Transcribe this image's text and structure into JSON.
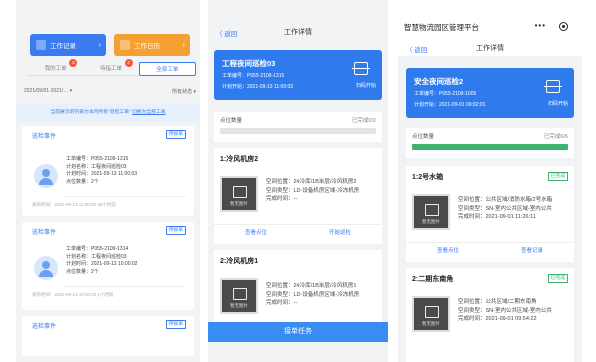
{
  "panel1": {
    "quick_actions": [
      {
        "label": "工作记录",
        "arrow": "›",
        "color": "#3a7cf0"
      },
      {
        "label": "工作日历",
        "arrow": "›",
        "color": "#f5a033"
      }
    ],
    "tabs": [
      {
        "label": "我的工单",
        "badge": "3"
      },
      {
        "label": "待指工单",
        "badge": "2"
      },
      {
        "label": "全部工单",
        "badge": ""
      }
    ],
    "filter": {
      "date": "2021/09/01-2021/…",
      "date_arrow": "▾",
      "status": "所有状态",
      "status_arrow": "▾"
    },
    "notice": {
      "text": "当前展示的列表为本月所有\"巡检工单\"",
      "link": "切换为全部工单"
    },
    "cards": [
      {
        "title": "巡检事件",
        "tag": "待接单",
        "no": "工单编号：P055-2109-1315",
        "name": "计划名称：工程夜间巡检03",
        "time": "计划时间：2021-09-13 11:00:03",
        "count": "点位数量：2个",
        "foot": "发布时间：2021-09-13 11:00:03 35小时前"
      },
      {
        "title": "巡检事件",
        "tag": "待接单",
        "no": "工单编号：P055-2109-1314",
        "name": "计划名称：工程夜间巡检03",
        "time": "计划时间：2021-09-13 10:00:02",
        "count": "点位数量：2个",
        "foot": "发布时间：2021-09-13 10:00:02 1小时前"
      },
      {
        "title": "巡检事件",
        "tag": "待接单"
      }
    ]
  },
  "panel2": {
    "back": "〈 返回",
    "title": "工作详情",
    "hero": {
      "name": "工程夜间巡检03",
      "no": "工单编号：P055-2109-1315",
      "start": "计划开始：2021-09-13 11:00:03",
      "scan_label": "扫码开始"
    },
    "points": {
      "label": "点位数量",
      "value": "已完成0/2",
      "progress": 0
    },
    "spots": [
      {
        "title": "1:冷风机房2",
        "thumb": "暂无图片",
        "area": "空间位置：2#冷库/1B米层/冷风机房2",
        "type": "空间类型：LD-设备机房区域-冷冻机房",
        "done": "完成时间：--",
        "actions": [
          "查看点位",
          "开始巡检"
        ]
      },
      {
        "title": "2:冷风机房1",
        "thumb": "暂无图片",
        "area": "空间位置：2#冷库/1B米层/冷风机房1",
        "type": "空间类型：LD-设备机房区域-冷冻机房",
        "done": "完成时间：--"
      }
    ],
    "bottom_button": "接单任务"
  },
  "panel3": {
    "brand": "智慧物流园区管理平台",
    "menu": "•••",
    "back": "〈 返回",
    "title": "工作详情",
    "hero": {
      "name": "安全夜间巡检2",
      "no": "工单编号：P055-2109-1005",
      "start": "计划开始：2021-09-01 09:02:01",
      "scan_label": "扫码开始"
    },
    "points": {
      "label": "点位数量",
      "value": "已完成6/6",
      "progress": 1
    },
    "spots": [
      {
        "title": "1:2号水箱",
        "tag": "已完成",
        "thumb": "暂无图片",
        "area": "空间位置：公共区域/消防水箱/2号水箱",
        "type": "空间类型：SN-室内公共区域-室内公共",
        "done": "完成时间：2021-09-01 11:26:11",
        "actions": [
          "查看点位",
          "查看记录"
        ]
      },
      {
        "title": "2:二期东南角",
        "tag": "已完成",
        "thumb": "暂无图片",
        "area": "空间位置：公共区域/二期东南角",
        "type": "空间类型：SN-室内公共区域-室内公共",
        "done": "完成时间：2021-09-01 09:54:22"
      }
    ]
  },
  "colors": {
    "primary": "#3a7cf0",
    "orange": "#f5a033",
    "success": "#3cb46e",
    "badge": "#f05a3a"
  }
}
